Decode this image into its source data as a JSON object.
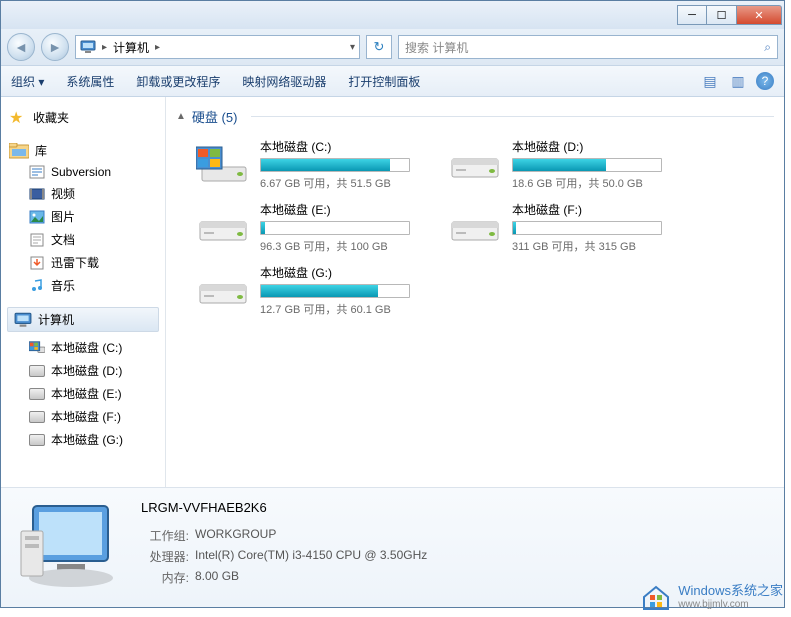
{
  "titlebar": {
    "min": "─",
    "max": "☐",
    "close": "✕"
  },
  "nav": {
    "back": "◄",
    "fwd": "►",
    "path_label": "计算机",
    "path_sep": "▸",
    "dropdown": "▾",
    "refresh": "↻",
    "search_placeholder": "搜索 计算机",
    "search_icon": "⌕"
  },
  "toolbar": {
    "organize": "组织 ▾",
    "sysprops": "系统属性",
    "uninstall": "卸载或更改程序",
    "mapnet": "映射网络驱动器",
    "ctrlpanel": "打开控制面板",
    "view_icon": "▤",
    "preview_icon": "▥",
    "help": "?"
  },
  "sidebar": {
    "favorites": "收藏夹",
    "libraries": "库",
    "lib_items": [
      {
        "icon": "subversion",
        "label": "Subversion"
      },
      {
        "icon": "video",
        "label": "视频"
      },
      {
        "icon": "picture",
        "label": "图片"
      },
      {
        "icon": "document",
        "label": "文档"
      },
      {
        "icon": "download",
        "label": "迅雷下载"
      },
      {
        "icon": "music",
        "label": "音乐"
      }
    ],
    "computer": "计算机",
    "disks": [
      "本地磁盘 (C:)",
      "本地磁盘 (D:)",
      "本地磁盘 (E:)",
      "本地磁盘 (F:)",
      "本地磁盘 (G:)"
    ]
  },
  "main": {
    "group_arrow": "▲",
    "group_title": "硬盘 (5)",
    "drives": [
      {
        "name": "本地磁盘 (C:)",
        "fill_pct": 87,
        "text": "6.67 GB 可用，共 51.5 GB",
        "windows": true
      },
      {
        "name": "本地磁盘 (D:)",
        "fill_pct": 63,
        "text": "18.6 GB 可用，共 50.0 GB",
        "windows": false
      },
      {
        "name": "本地磁盘 (E:)",
        "fill_pct": 3,
        "text": "96.3 GB 可用，共 100 GB",
        "windows": false
      },
      {
        "name": "本地磁盘 (F:)",
        "fill_pct": 2,
        "text": "311 GB 可用，共 315 GB",
        "windows": false
      },
      {
        "name": "本地磁盘 (G:)",
        "fill_pct": 79,
        "text": "12.7 GB 可用，共 60.1 GB",
        "windows": false
      }
    ]
  },
  "details": {
    "pc_name": "LRGM-VVFHAEB2K6",
    "workgroup_label": "工作组:",
    "workgroup": "WORKGROUP",
    "cpu_label": "处理器:",
    "cpu": "Intel(R) Core(TM) i3-4150 CPU @ 3.50GHz",
    "ram_label": "内存:",
    "ram": "8.00 GB"
  },
  "watermark": {
    "line1": "Windows系统之家",
    "line2": "www.bjjmlv.com"
  }
}
